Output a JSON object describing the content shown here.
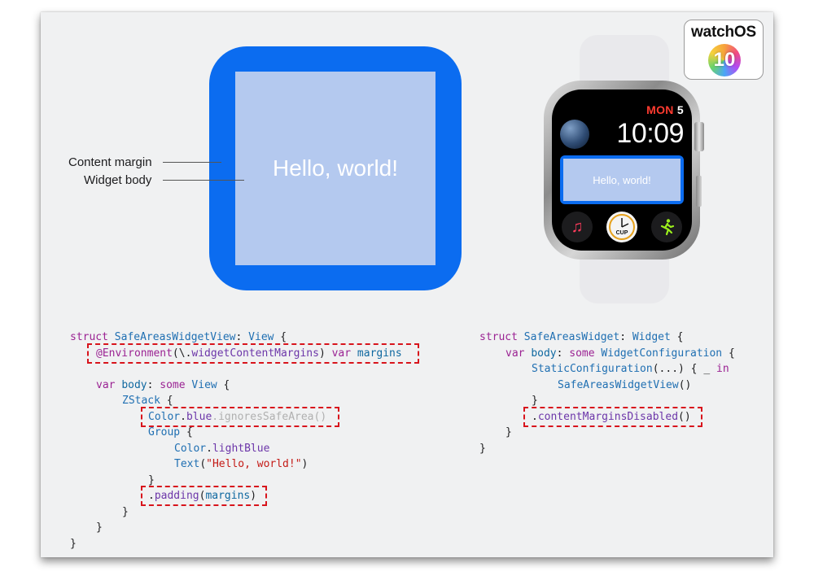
{
  "badge": {
    "title": "watchOS",
    "version": "10"
  },
  "widget_diagram": {
    "content_margin_label": "Content margin",
    "widget_body_label": "Widget body",
    "hello_text": "Hello, world!",
    "colors": {
      "blue": "#0b6cf0",
      "light_blue": "#b4c9ef"
    }
  },
  "watch": {
    "day": "MON",
    "date": "5",
    "time": "10:09",
    "widget_text": "Hello, world!",
    "timer_label": "CUP",
    "complications": [
      "music-icon",
      "timer-icon",
      "fitness-icon"
    ]
  },
  "code_left": {
    "l1": {
      "kw": "struct",
      "name": "SafeAreasWidgetView",
      "colon": ": ",
      "type": "View",
      "tail": " {"
    },
    "l2": {
      "attr": "@Environment",
      "open": "(\\.",
      "prop": "widgetContentMargins",
      "close": ") ",
      "kw": "var",
      "name": "margins"
    },
    "l3": {
      "kw": "var",
      "name": "body",
      "colon": ": ",
      "kw2": "some",
      "type": "View",
      "tail": " {"
    },
    "l4": {
      "type": "ZStack",
      "tail": " {"
    },
    "l5": {
      "type": "Color",
      "dot1": ".",
      "prop": "blue",
      "faded": ".ignoresSafeArea()"
    },
    "l6": {
      "type": "Group",
      "tail": " {"
    },
    "l7": {
      "type": "Color",
      "dot": ".",
      "prop": "lightBlue"
    },
    "l8": {
      "type": "Text",
      "open": "(",
      "str": "\"Hello, world!\"",
      "close": ")"
    },
    "l9": "}",
    "l10": {
      "dot": ".",
      "fn": "padding",
      "open": "(",
      "arg": "margins",
      "close": ")"
    },
    "l11": "}",
    "l12": "}",
    "l13": "}"
  },
  "code_right": {
    "l1": {
      "kw": "struct",
      "name": "SafeAreasWidget",
      "colon": ": ",
      "type": "Widget",
      "tail": " {"
    },
    "l2": {
      "kw": "var",
      "name": "body",
      "colon": ": ",
      "kw2": "some",
      "type": "WidgetConfiguration",
      "tail": " {"
    },
    "l3": {
      "type": "StaticConfiguration",
      "mid": "(...) { _ ",
      "kw": "in"
    },
    "l4": {
      "type": "SafeAreasWidgetView",
      "tail": "()"
    },
    "l5": "}",
    "l6": {
      "dot": ".",
      "fn": "contentMarginsDisabled",
      "tail": "()"
    },
    "l7": "}",
    "l8": "}"
  },
  "highlight_color": "#d8141c"
}
